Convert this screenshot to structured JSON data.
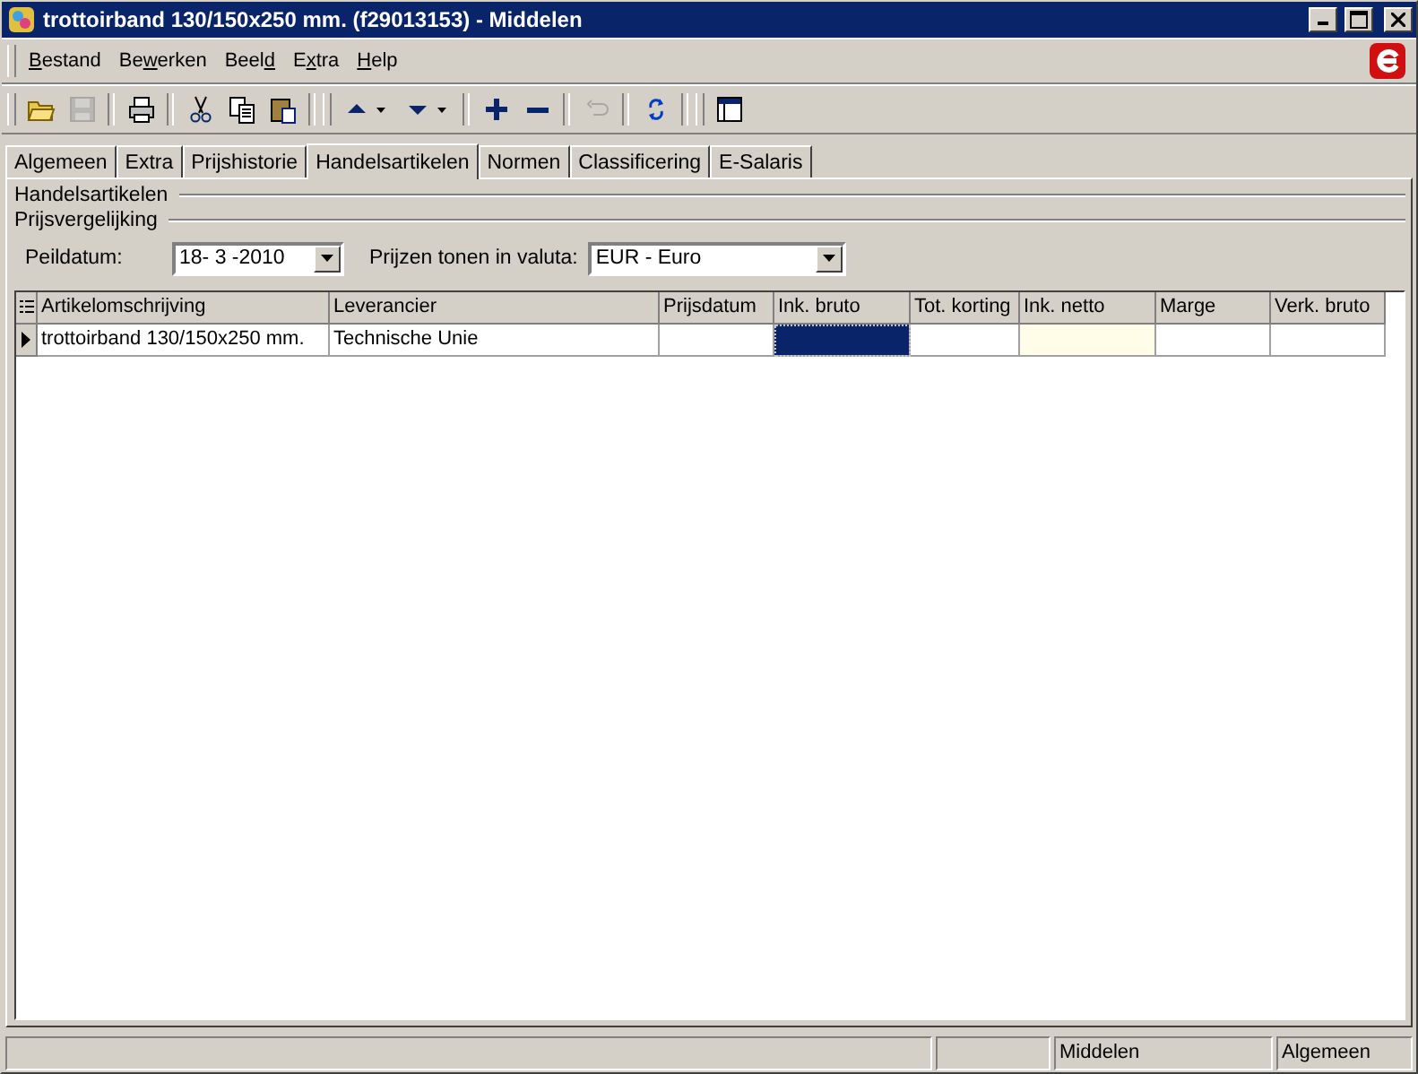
{
  "window": {
    "title": "trottoirband 130/150x250 mm. (f29013153) - Middelen"
  },
  "menu": [
    "Bestand",
    "Bewerken",
    "Beeld",
    "Extra",
    "Help"
  ],
  "toolbar": [
    {
      "kind": "open",
      "disabled": false
    },
    {
      "kind": "save",
      "disabled": true
    },
    {
      "kind": "print",
      "disabled": false
    },
    {
      "kind": "cut",
      "disabled": false
    },
    {
      "kind": "copy",
      "disabled": false
    },
    {
      "kind": "paste",
      "disabled": false
    },
    {
      "kind": "up",
      "disabled": false
    },
    {
      "kind": "down",
      "disabled": false
    },
    {
      "kind": "add",
      "disabled": false
    },
    {
      "kind": "remove",
      "disabled": false
    },
    {
      "kind": "undo",
      "disabled": true
    },
    {
      "kind": "refresh",
      "disabled": false
    },
    {
      "kind": "layout",
      "disabled": false
    }
  ],
  "tabs": [
    {
      "label": "Algemeen",
      "selected": false
    },
    {
      "label": "Extra",
      "selected": false
    },
    {
      "label": "Prijshistorie",
      "selected": false
    },
    {
      "label": "Handelsartikelen",
      "selected": true
    },
    {
      "label": "Normen",
      "selected": false
    },
    {
      "label": "Classificering",
      "selected": false
    },
    {
      "label": "E-Salaris",
      "selected": false
    }
  ],
  "sections": [
    "Handelsartikelen",
    "Prijsvergelijking"
  ],
  "filters": {
    "date_label": "Peildatum:",
    "date_value": "18- 3 -2010",
    "currency_label": "Prijzen tonen in valuta:",
    "currency_value": "EUR - Euro"
  },
  "table": {
    "columns": [
      "Artikelomschrijving",
      "Leverancier",
      "Prijsdatum",
      "Ink. bruto",
      "Tot. korting",
      "Ink. netto",
      "Marge",
      "Verk. bruto"
    ],
    "rows": [
      {
        "current": true,
        "cells": [
          {
            "text": "trottoirband 130/150x250 mm.",
            "selected": false,
            "highlighted": false
          },
          {
            "text": "Technische Unie",
            "selected": false,
            "highlighted": false
          },
          {
            "selected": false,
            "highlighted": false
          },
          {
            "selected": true,
            "highlighted": false
          },
          {
            "selected": false,
            "highlighted": false
          },
          {
            "selected": false,
            "highlighted": true
          },
          {
            "selected": false,
            "highlighted": false
          },
          {
            "selected": false,
            "highlighted": false
          }
        ]
      }
    ]
  },
  "status_bar": [
    "Middelen",
    "Algemeen"
  ]
}
